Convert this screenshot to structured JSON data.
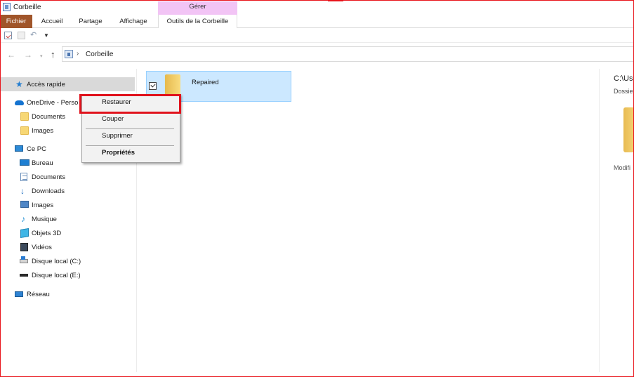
{
  "window": {
    "title": "Corbeille"
  },
  "ribbon": {
    "manage_group": "Gérer",
    "tabs": [
      "Fichier",
      "Accueil",
      "Partage",
      "Affichage",
      "Outils de la Corbeille"
    ]
  },
  "address": {
    "path": "Corbeille",
    "separator": "›"
  },
  "nav": {
    "back_icon": "←",
    "forward_icon": "→",
    "recent_icon": "▾",
    "up_icon": "↑",
    "items": [
      {
        "label": "Accès rapide",
        "icon": "star-icon"
      },
      {
        "label": "OneDrive - Perso",
        "icon": "cloud-icon"
      },
      {
        "label": "Documents",
        "icon": "folder-icon"
      },
      {
        "label": "Images",
        "icon": "folder-icon"
      },
      {
        "label": "Ce PC",
        "icon": "pc-icon"
      },
      {
        "label": "Bureau",
        "icon": "desktop-icon"
      },
      {
        "label": "Documents",
        "icon": "documents-icon"
      },
      {
        "label": "Downloads",
        "icon": "download-icon"
      },
      {
        "label": "Images",
        "icon": "images-icon"
      },
      {
        "label": "Musique",
        "icon": "music-icon"
      },
      {
        "label": "Objets 3D",
        "icon": "3d-objects-icon"
      },
      {
        "label": "Vidéos",
        "icon": "video-icon"
      },
      {
        "label": "Disque local (C:)",
        "icon": "drive-icon"
      },
      {
        "label": "Disque local (E:)",
        "icon": "drive-icon"
      },
      {
        "label": "Réseau",
        "icon": "network-icon"
      }
    ]
  },
  "content": {
    "items": [
      {
        "name": "Repaired",
        "checked": true
      }
    ]
  },
  "context_menu": {
    "items": [
      "Restaurer",
      "Couper",
      "Supprimer",
      "Propriétés"
    ]
  },
  "details": {
    "path": "C:\\Us",
    "type": "Dossie",
    "modified": "Modifi"
  },
  "colors": {
    "file_tab": "#a0552a",
    "manage_group": "#f2c4f5",
    "selection": "#cce8ff",
    "highlight_border": "#e0121c"
  }
}
